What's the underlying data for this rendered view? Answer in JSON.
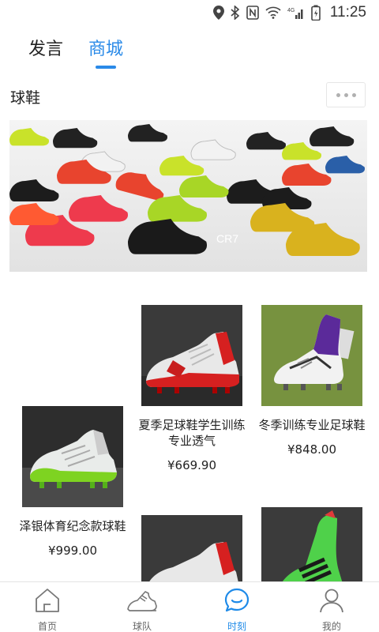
{
  "status_bar": {
    "time": "11:25",
    "network": "4G"
  },
  "top_tabs": [
    {
      "label": "发言"
    },
    {
      "label": "商城"
    }
  ],
  "active_tab": "商城",
  "section": {
    "title": "球鞋"
  },
  "products": [
    {
      "name": "夏季足球鞋学生训练专业透气",
      "price": "¥669.90"
    },
    {
      "name": "冬季训练专业足球鞋",
      "price": "¥848.00"
    },
    {
      "name": "泽银体育纪念款球鞋",
      "price": "¥999.00"
    }
  ],
  "bottom_nav": [
    {
      "label": "首页",
      "icon": "home-icon"
    },
    {
      "label": "球队",
      "icon": "shoe-icon"
    },
    {
      "label": "时刻",
      "icon": "chat-icon"
    },
    {
      "label": "我的",
      "icon": "user-icon"
    }
  ],
  "active_nav": "时刻",
  "colors": {
    "accent": "#2a8ae8",
    "text": "#222222",
    "muted": "#666666",
    "divider": "#e3e3e3"
  }
}
